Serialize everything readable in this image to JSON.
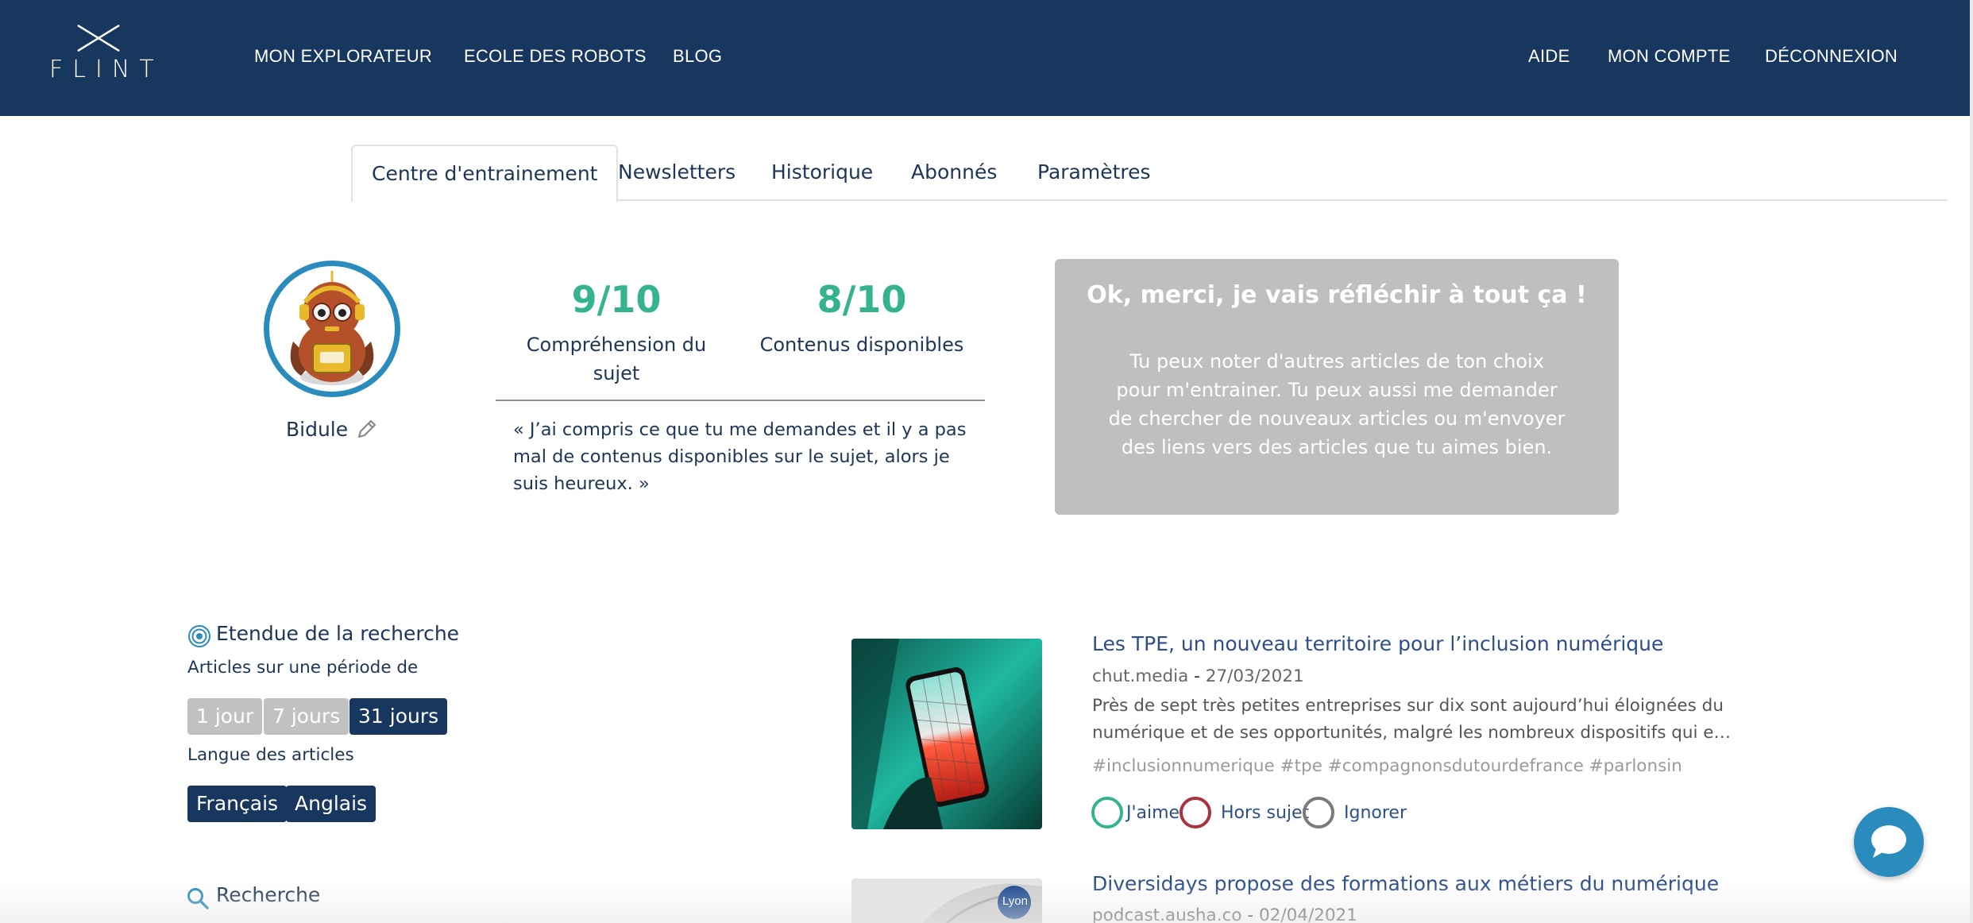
{
  "header": {
    "logo_text": "FLINT",
    "nav_left": [
      "MON EXPLORATEUR",
      "ECOLE DES ROBOTS",
      "BLOG"
    ],
    "nav_right": [
      "AIDE",
      "MON COMPTE",
      "DÉCONNEXION"
    ]
  },
  "tabs": [
    "Centre d'entrainement",
    "Newsletters",
    "Historique",
    "Abonnés",
    "Paramètres"
  ],
  "active_tab": "Centre d'entrainement",
  "robot": {
    "name": "Bidule",
    "scores": [
      {
        "value": "9/10",
        "label": "Compréhension du sujet"
      },
      {
        "value": "8/10",
        "label": "Contenus disponibles"
      }
    ],
    "quote": "« J’ai compris ce que tu me demandes et il y a pas mal de contenus disponibles sur le sujet, alors je suis heureux. »"
  },
  "message": {
    "title": "Ok, merci, je vais réfléchir à tout ça !",
    "body": "Tu peux noter d'autres articles de ton choix pour m'entrainer. Tu peux aussi me demander de chercher de nouveaux articles ou m'envoyer des liens vers des articles que tu aimes bien."
  },
  "filters": {
    "scope_title": "Etendue de la recherche",
    "period_label": "Articles sur une période de",
    "periods": [
      {
        "label": "1 jour",
        "selected": false
      },
      {
        "label": "7 jours",
        "selected": false
      },
      {
        "label": "31 jours",
        "selected": true
      }
    ],
    "language_label": "Langue des articles",
    "languages": [
      {
        "label": "Français",
        "selected": true
      },
      {
        "label": "Anglais",
        "selected": true
      }
    ],
    "search_title": "Recherche"
  },
  "articles": [
    {
      "title": "Les TPE, un nouveau territoire pour l’inclusion numérique",
      "source": "chut.media",
      "date": "27/03/2021",
      "description": "Près de sept très petites entreprises sur dix sont aujourd’hui éloignées du numérique et de ses opportunités, malgré les nombreux dispositifs qui e…",
      "tags": "#inclusionnumerique #tpe #compagnonsdutourdefrance #parlonsin",
      "thumb_icon": "smartphone-image"
    },
    {
      "title": "Diversidays propose des formations aux métiers du numérique",
      "source": "podcast.ausha.co",
      "date": "02/04/2021",
      "thumb_badge": "Lyon"
    }
  ],
  "actions": [
    "J'aime",
    "Hors sujet",
    "Ignorer"
  ],
  "colors": {
    "navy": "#17375e",
    "teal": "#35b38f",
    "accent_blue": "#2a8bbd",
    "like": "#35b38f",
    "off_topic": "#a8333f",
    "ignore": "#7a7a7a",
    "pill_inactive": "#c1c1c1"
  },
  "icons": [
    "close-x-logo-icon",
    "pencil-icon",
    "target-icon",
    "search-icon",
    "chat-bubble-icon"
  ]
}
